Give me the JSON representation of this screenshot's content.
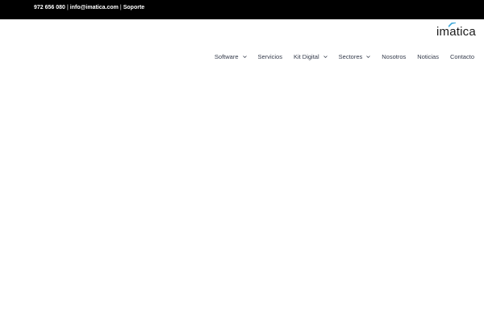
{
  "topbar": {
    "phone": "972 656 080",
    "email": "info@imatica.com",
    "support": "Soporte",
    "separator": "|"
  },
  "logo": {
    "text": "imatica",
    "accent_color": "#3aa6d8"
  },
  "nav": {
    "items": [
      {
        "label": "Software",
        "has_dropdown": true
      },
      {
        "label": "Servicios",
        "has_dropdown": false
      },
      {
        "label": "Kit Digital",
        "has_dropdown": true
      },
      {
        "label": "Sectores",
        "has_dropdown": true
      },
      {
        "label": "Nosotros",
        "has_dropdown": false
      },
      {
        "label": "Noticias",
        "has_dropdown": false
      },
      {
        "label": "Contacto",
        "has_dropdown": false
      }
    ]
  },
  "icons": {
    "dropdown": "chevron-down-icon"
  }
}
